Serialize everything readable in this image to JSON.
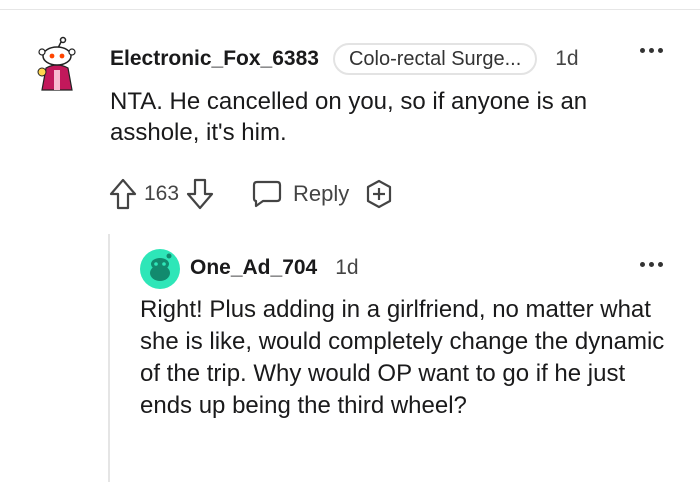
{
  "comment": {
    "author": "Electronic_Fox_6383",
    "flair": "Colo-rectal Surge...",
    "age": "1d",
    "body": "NTA. He cancelled on you, so if anyone is an asshole, it's him.",
    "score": "163",
    "reply_label": "Reply",
    "avatar_icon": "snoo-avatar-icon",
    "colors": {
      "text": "#1a1a1b",
      "muted": "#444444",
      "thread_line": "#e5e5e5"
    }
  },
  "reply": {
    "author": "One_Ad_704",
    "age": "1d",
    "body": "Right! Plus adding in a girlfriend, no matter what she is like, would completely change the dynamic of the trip. Why would OP want to go if he just ends up being the third wheel?",
    "avatar_icon": "teal-avatar-icon",
    "colors": {
      "avatar": "#2ee6b8"
    }
  }
}
